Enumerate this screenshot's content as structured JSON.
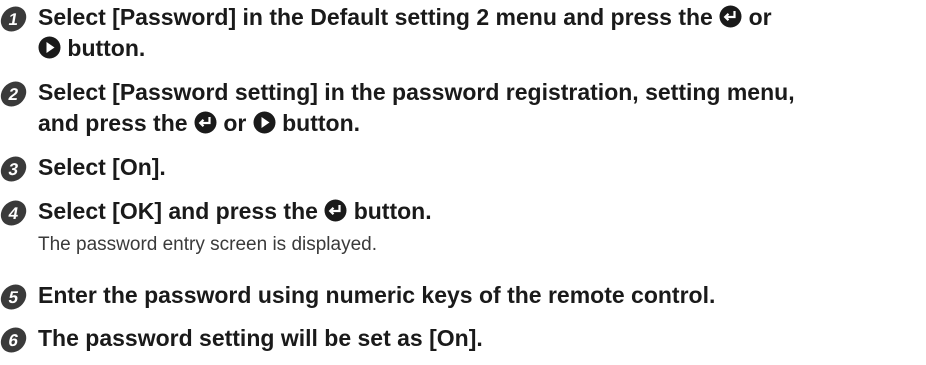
{
  "steps": [
    {
      "number": "1",
      "lines": [
        [
          "Select [Password] in the Default setting 2 menu and press the ",
          {
            "icon": "enter-button-icon"
          },
          " or"
        ],
        [
          {
            "icon": "right-arrow-button-icon"
          },
          " button."
        ]
      ]
    },
    {
      "number": "2",
      "lines": [
        [
          "Select [Password setting] in the password registration, setting menu,"
        ],
        [
          "and press the ",
          {
            "icon": "enter-button-icon"
          },
          " or ",
          {
            "icon": "right-arrow-button-icon"
          },
          " button."
        ]
      ]
    },
    {
      "number": "3",
      "lines": [
        [
          "Select [On]."
        ]
      ]
    },
    {
      "number": "4",
      "lines": [
        [
          "Select [OK] and press the ",
          {
            "icon": "enter-button-icon"
          },
          " button."
        ]
      ],
      "note": "The password entry screen is displayed."
    },
    {
      "number": "5",
      "lines": [
        [
          "Enter the password using numeric keys of the remote control."
        ]
      ]
    },
    {
      "number": "6",
      "lines": [
        [
          "The password setting will be set as [On]."
        ]
      ]
    }
  ],
  "colors": {
    "badge": "#3a3a3a",
    "text": "#1a1a1a",
    "note": "#3a3a3a"
  }
}
